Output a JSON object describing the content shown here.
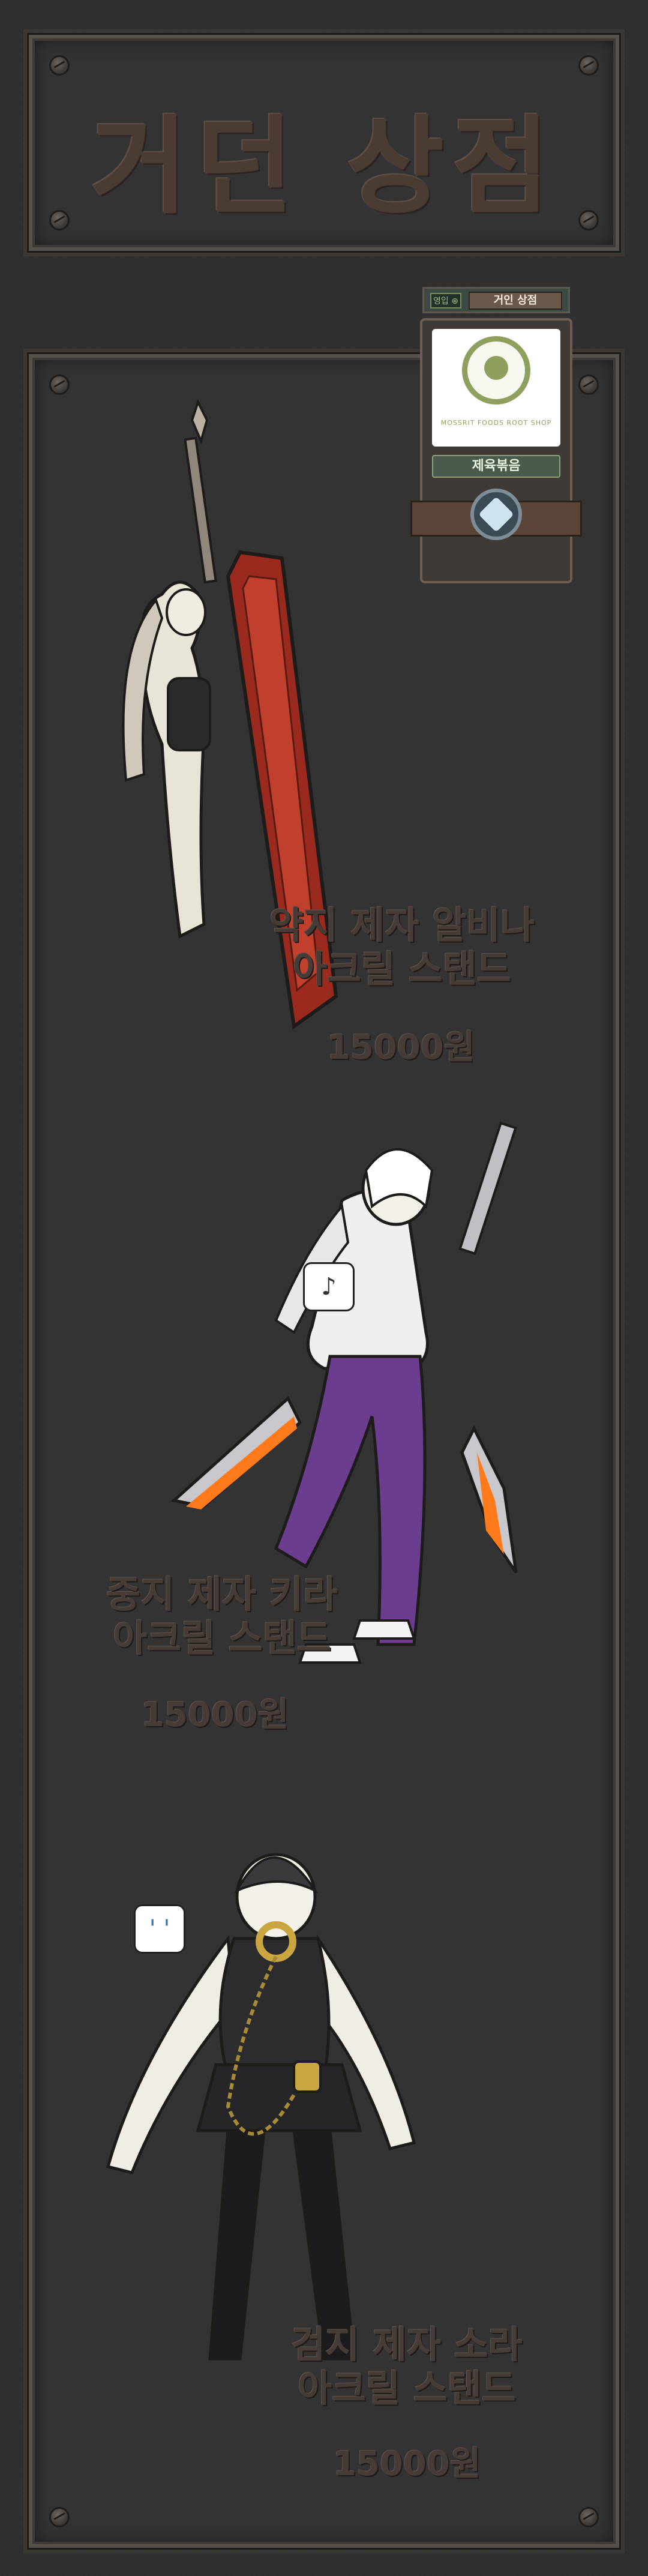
{
  "header": {
    "title": "거던 상점"
  },
  "badge": {
    "tag": "영입 ⊕",
    "label": "거인 상점",
    "logo_caption": "MOSSRIT FOODS ROOT SHOP",
    "name": "제육볶음"
  },
  "products": [
    {
      "name_line1": "약지 제자 알비나",
      "name_line2": "아크릴 스탠드",
      "price": "15000원"
    },
    {
      "name_line1": "중지 제자 키라",
      "name_line2": "아크릴 스탠드",
      "price": "15000원"
    },
    {
      "name_line1": "검지 제자 소라",
      "name_line2": "아크릴 스탠드",
      "price": "15000원"
    }
  ],
  "bubbles": {
    "note": "♪",
    "sweat": "' '"
  },
  "colors": {
    "background": "#2f2f30",
    "frame": "#57514b",
    "text": "#453c37",
    "accent_green": "#8fa05e"
  }
}
